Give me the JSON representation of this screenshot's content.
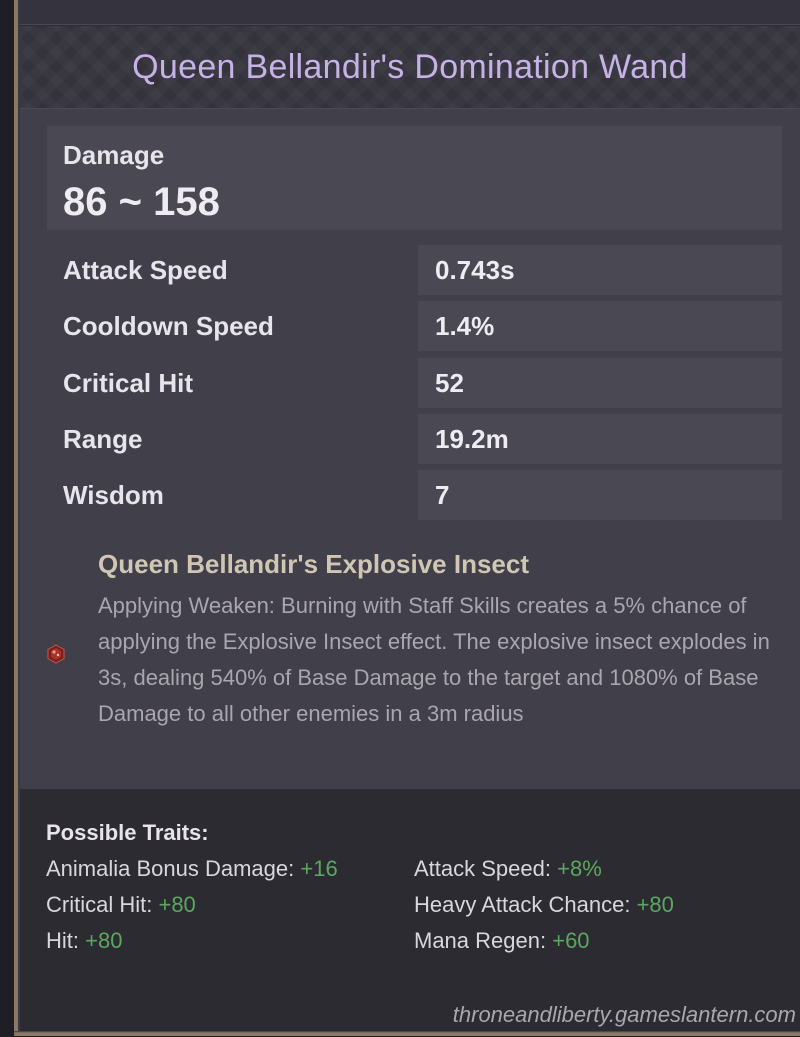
{
  "item": {
    "title": "Queen Bellandir's Domination Wand"
  },
  "damage": {
    "label": "Damage",
    "value": "86 ~ 158"
  },
  "stats": [
    {
      "name": "Attack Speed",
      "value": "0.743s"
    },
    {
      "name": "Cooldown Speed",
      "value": "1.4%"
    },
    {
      "name": "Critical Hit",
      "value": "52"
    },
    {
      "name": "Range",
      "value": "19.2m"
    },
    {
      "name": "Wisdom",
      "value": "7"
    }
  ],
  "skill": {
    "icon": "gem-icon",
    "title": "Queen Bellandir's Explosive Insect",
    "description": "Applying Weaken: Burning with Staff Skills creates a 5% chance of applying the Explosive Insect effect. The explosive insect explodes in 3s, dealing 540% of Base Damage to the target and 1080% of Base Damage to all other enemies in a 3m radius"
  },
  "traits": {
    "heading": "Possible Traits:",
    "items": [
      {
        "name": "Animalia Bonus Damage:",
        "bonus": "+16"
      },
      {
        "name": "Attack Speed:",
        "bonus": "+8%"
      },
      {
        "name": "Critical Hit:",
        "bonus": "+80"
      },
      {
        "name": "Heavy Attack Chance:",
        "bonus": "+80"
      },
      {
        "name": "Hit:",
        "bonus": "+80"
      },
      {
        "name": "Mana Regen:",
        "bonus": "+60"
      }
    ]
  },
  "watermark": "throneandliberty.gameslantern.com",
  "colors": {
    "title": "#c6b2e6",
    "bonus": "#5aa85e",
    "skill_title": "#cfc6b4",
    "border_gold": "#8a7a64"
  }
}
